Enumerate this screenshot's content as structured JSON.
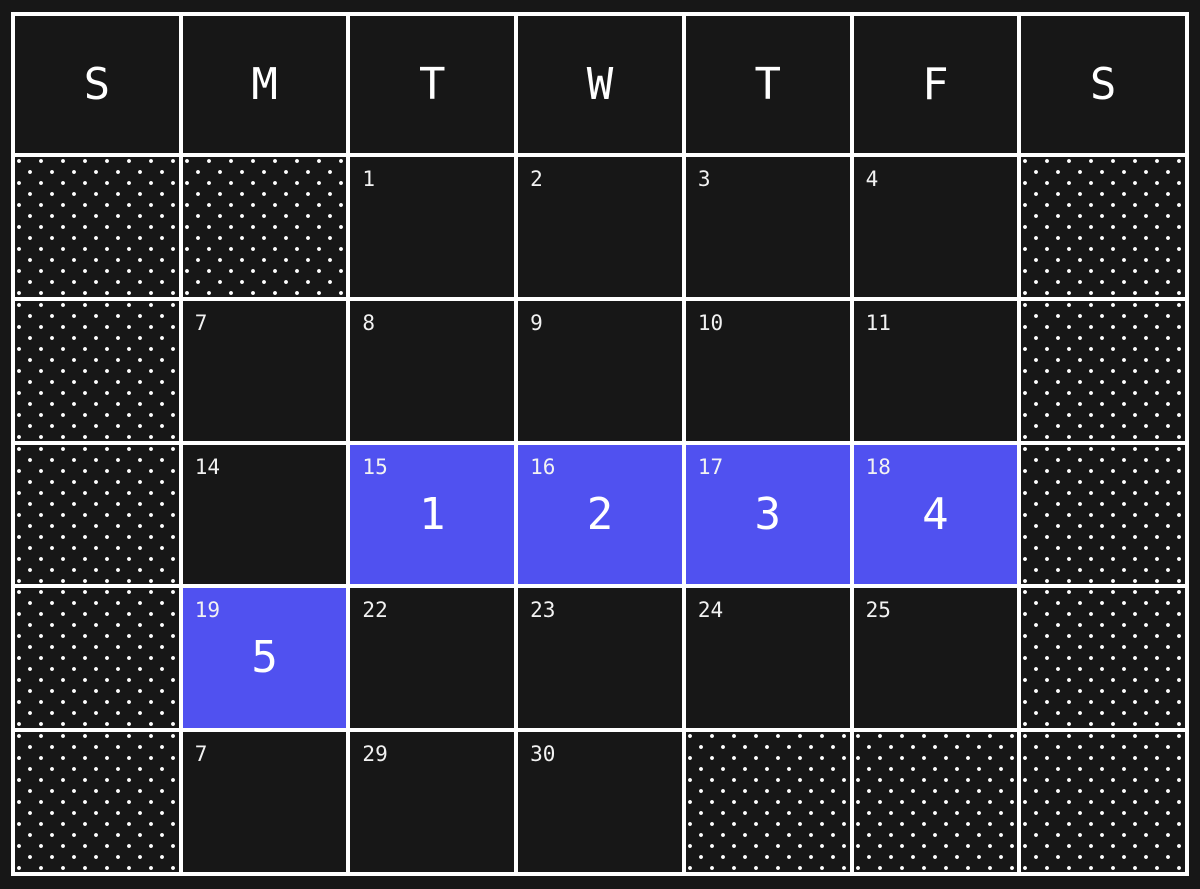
{
  "weekdays": [
    "S",
    "M",
    "T",
    "W",
    "T",
    "F",
    "S"
  ],
  "colors": {
    "background": "#171717",
    "grid_lines": "#ffffff",
    "highlight": "#5051f0"
  },
  "weeks": [
    [
      {
        "type": "empty-pattern"
      },
      {
        "type": "empty-pattern"
      },
      {
        "type": "day",
        "day": "1"
      },
      {
        "type": "day",
        "day": "2"
      },
      {
        "type": "day",
        "day": "3"
      },
      {
        "type": "day",
        "day": "4"
      },
      {
        "type": "empty-pattern"
      }
    ],
    [
      {
        "type": "empty-pattern"
      },
      {
        "type": "day",
        "day": "7"
      },
      {
        "type": "day",
        "day": "8"
      },
      {
        "type": "day",
        "day": "9"
      },
      {
        "type": "day",
        "day": "10"
      },
      {
        "type": "day",
        "day": "11"
      },
      {
        "type": "empty-pattern"
      }
    ],
    [
      {
        "type": "empty-pattern"
      },
      {
        "type": "day",
        "day": "14"
      },
      {
        "type": "day",
        "day": "15",
        "highlight": true,
        "session": "1"
      },
      {
        "type": "day",
        "day": "16",
        "highlight": true,
        "session": "2"
      },
      {
        "type": "day",
        "day": "17",
        "highlight": true,
        "session": "3"
      },
      {
        "type": "day",
        "day": "18",
        "highlight": true,
        "session": "4"
      },
      {
        "type": "empty-pattern"
      }
    ],
    [
      {
        "type": "empty-pattern"
      },
      {
        "type": "day",
        "day": "19",
        "highlight": true,
        "session": "5"
      },
      {
        "type": "day",
        "day": "22"
      },
      {
        "type": "day",
        "day": "23"
      },
      {
        "type": "day",
        "day": "24"
      },
      {
        "type": "day",
        "day": "25"
      },
      {
        "type": "empty-pattern"
      }
    ],
    [
      {
        "type": "empty-pattern"
      },
      {
        "type": "day",
        "day": "7"
      },
      {
        "type": "day",
        "day": "29"
      },
      {
        "type": "day",
        "day": "30"
      },
      {
        "type": "empty-pattern"
      },
      {
        "type": "empty-pattern"
      },
      {
        "type": "empty-pattern"
      }
    ]
  ]
}
